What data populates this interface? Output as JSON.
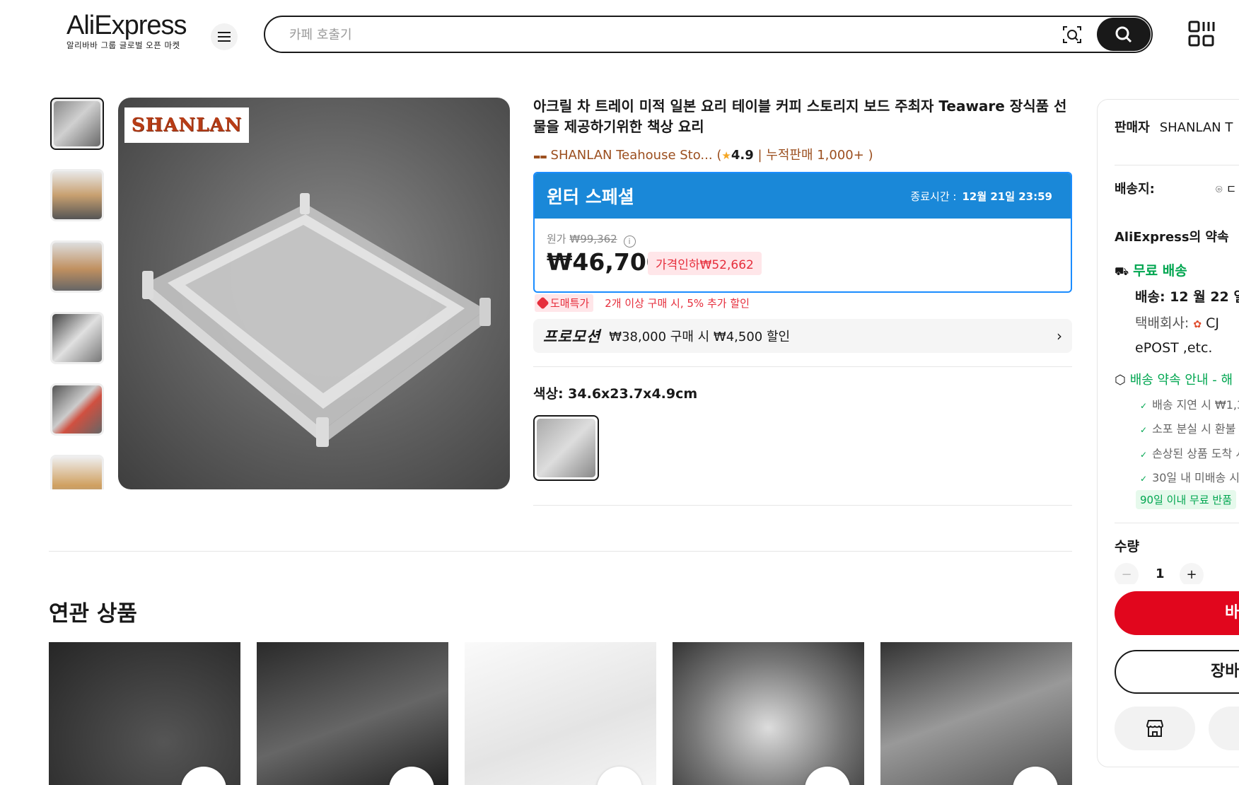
{
  "header": {
    "logo_main": "AliExpress",
    "logo_sub": "알리바바 그룹 글로벌 오픈 마켓",
    "search_placeholder": "카페 호출기"
  },
  "product": {
    "title": "아크릴 차 트레이 미적 일본 요리 테이블 커피 스토리지 보드 주최자 Teaware 장식품 선물을 제공하기위한 책상 요리",
    "brand_badge": "SHANLAN",
    "store_name": "SHANLAN Teahouse Sto...",
    "rating": "4.9",
    "sold": "누적판매 1,000+",
    "deal_title": "윈터 스페셜",
    "deal_end_label": "종료시간 :",
    "deal_end_time": "12월 21일 23:59",
    "orig_label": "원가",
    "orig_price": "₩99,362",
    "price": "₩46,700",
    "price_cut": "가격인하₩52,662",
    "wholesale_tag": "도매특가",
    "wholesale_text": "2개 이상 구매 시, 5% 추가 할인",
    "promo_label": "프로모션",
    "promo_text": "₩38,000 구매 시 ₩4,500 할인",
    "color_label": "색상: 34.6x23.7x4.9cm"
  },
  "related": {
    "title": "연관 상품"
  },
  "side": {
    "seller_label": "판매자",
    "seller_name": "SHANLAN T",
    "ship_to_label": "배송지:",
    "ship_to_value": "ㄷ",
    "promise_title": "AliExpress의 약속",
    "free_shipping": "무료 배송",
    "delivery": "배송: 12 월 22 일",
    "courier_label": "택배회사:",
    "courier_value": "CJ",
    "courier_line2": "ePOST ,etc.",
    "guide": "배송 약속 안내 - 해",
    "guarantees": [
      "배송 지연 시 ₩1,3",
      "소포 분실 시 환불",
      "손상된 상품 도착 시",
      "30일 내 미배송 시"
    ],
    "return_badge": "90일 이내 무료 반품",
    "qty_label": "수량",
    "qty_value": "1",
    "buy_label": "바",
    "cart_label": "장바"
  },
  "colors": {
    "accent_red": "#e1061d",
    "deal_blue": "#1a88d8",
    "green": "#00a650"
  }
}
